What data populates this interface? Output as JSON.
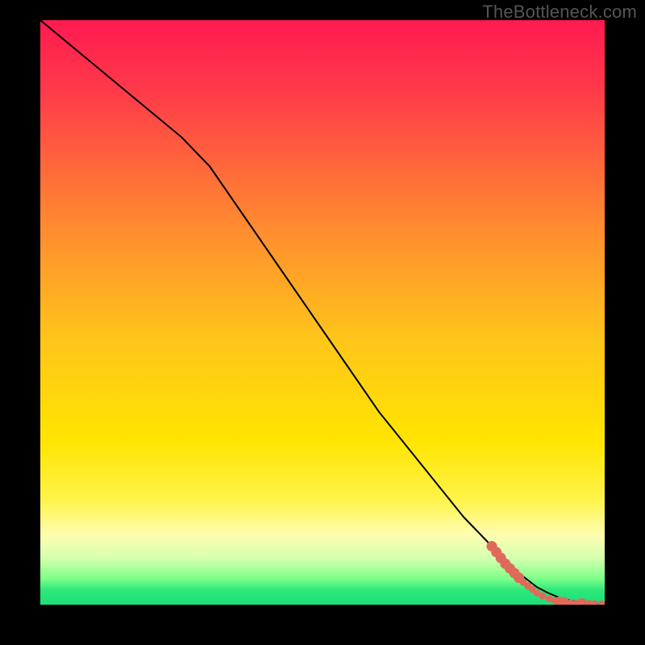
{
  "attribution": "TheBottleneck.com",
  "chart_data": {
    "type": "line",
    "title": "",
    "xlabel": "",
    "ylabel": "",
    "xlim": [
      0,
      100
    ],
    "ylim": [
      0,
      100
    ],
    "background_gradient": {
      "stops": [
        {
          "pos": 0.0,
          "color": "#ff1a50"
        },
        {
          "pos": 0.12,
          "color": "#ff3a4a"
        },
        {
          "pos": 0.35,
          "color": "#ff8a30"
        },
        {
          "pos": 0.55,
          "color": "#ffc61a"
        },
        {
          "pos": 0.72,
          "color": "#ffe500"
        },
        {
          "pos": 0.82,
          "color": "#fff34a"
        },
        {
          "pos": 0.88,
          "color": "#fffdb0"
        },
        {
          "pos": 0.92,
          "color": "#d6ffb0"
        },
        {
          "pos": 0.955,
          "color": "#7fff8a"
        },
        {
          "pos": 0.975,
          "color": "#2ee87a"
        },
        {
          "pos": 1.0,
          "color": "#1adf7a"
        }
      ]
    },
    "series": [
      {
        "name": "bottleneck-curve",
        "color": "#000000",
        "stroke_width": 2,
        "x": [
          0,
          5,
          10,
          15,
          20,
          25,
          30,
          35,
          40,
          45,
          50,
          55,
          60,
          65,
          70,
          75,
          80,
          82,
          84,
          86,
          88,
          90,
          92,
          94,
          96,
          98,
          100
        ],
        "y": [
          100,
          96,
          92,
          88,
          84,
          80,
          75,
          68,
          61,
          54,
          47,
          40,
          33,
          27,
          21,
          15,
          10,
          8,
          6,
          4.5,
          3,
          2,
          1.2,
          0.7,
          0.4,
          0.2,
          0.1
        ]
      }
    ],
    "marker_points": {
      "color": "#e06a5a",
      "radius_small": 4.5,
      "radius_large": 6.5,
      "points": [
        {
          "x": 80.0,
          "y": 10.0,
          "r": "large"
        },
        {
          "x": 80.8,
          "y": 9.0,
          "r": "large"
        },
        {
          "x": 81.6,
          "y": 8.0,
          "r": "large"
        },
        {
          "x": 82.4,
          "y": 7.0,
          "r": "large"
        },
        {
          "x": 83.2,
          "y": 6.2,
          "r": "large"
        },
        {
          "x": 84.0,
          "y": 5.4,
          "r": "large"
        },
        {
          "x": 84.8,
          "y": 4.6,
          "r": "large"
        },
        {
          "x": 85.6,
          "y": 3.8,
          "r": "small"
        },
        {
          "x": 86.4,
          "y": 3.2,
          "r": "small"
        },
        {
          "x": 87.2,
          "y": 2.6,
          "r": "small"
        },
        {
          "x": 88.0,
          "y": 2.0,
          "r": "small"
        },
        {
          "x": 89.0,
          "y": 1.5,
          "r": "small"
        },
        {
          "x": 90.2,
          "y": 1.0,
          "r": "small"
        },
        {
          "x": 91.2,
          "y": 0.7,
          "r": "small"
        },
        {
          "x": 92.0,
          "y": 0.5,
          "r": "large"
        },
        {
          "x": 92.8,
          "y": 0.4,
          "r": "large"
        },
        {
          "x": 94.0,
          "y": 0.3,
          "r": "small"
        },
        {
          "x": 95.0,
          "y": 0.25,
          "r": "small"
        },
        {
          "x": 96.0,
          "y": 0.2,
          "r": "large"
        },
        {
          "x": 97.2,
          "y": 0.18,
          "r": "small"
        },
        {
          "x": 98.2,
          "y": 0.15,
          "r": "small"
        },
        {
          "x": 99.5,
          "y": 0.12,
          "r": "small"
        }
      ]
    }
  }
}
